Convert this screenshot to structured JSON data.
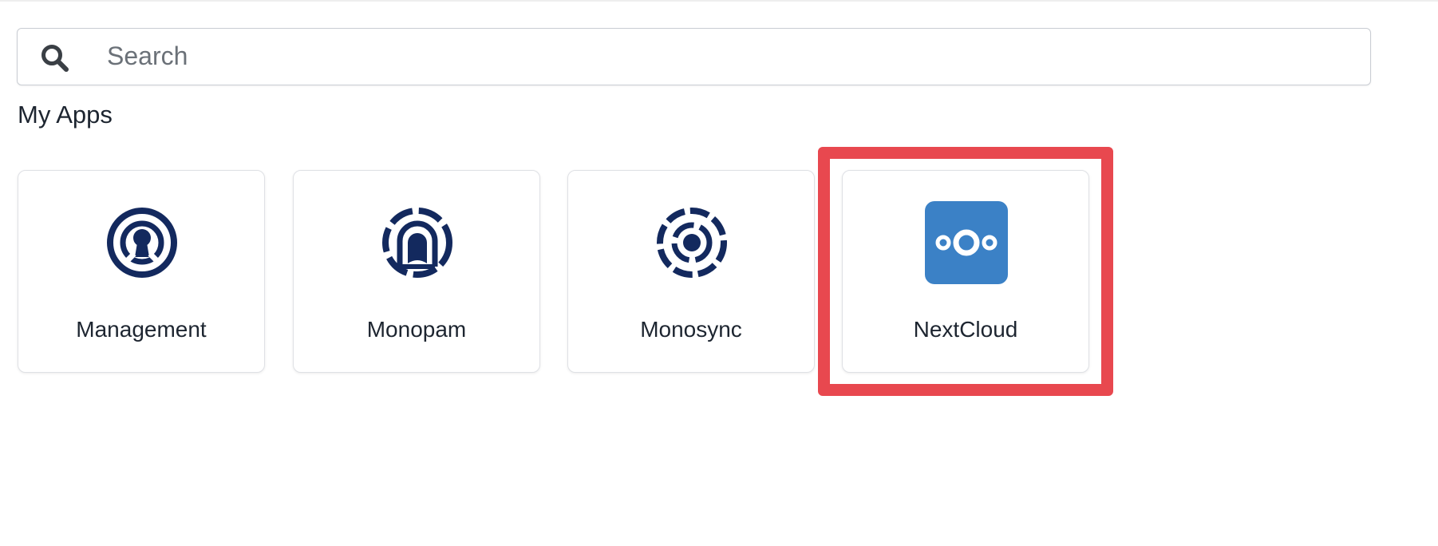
{
  "search": {
    "placeholder": "Search",
    "value": ""
  },
  "section": {
    "title": "My Apps"
  },
  "apps": [
    {
      "label": "Management",
      "icon": "management-icon",
      "icon_color": "#13295e"
    },
    {
      "label": "Monopam",
      "icon": "monopam-icon",
      "icon_color": "#13295e"
    },
    {
      "label": "Monosync",
      "icon": "monosync-icon",
      "icon_color": "#13295e"
    },
    {
      "label": "NextCloud",
      "icon": "nextcloud-icon",
      "icon_color": "#3b81c6"
    }
  ],
  "colors": {
    "brand_navy": "#13295e",
    "nextcloud_blue": "#3b81c6",
    "highlight_red": "#e8484f",
    "text": "#1d2530",
    "placeholder": "#6b7178"
  }
}
